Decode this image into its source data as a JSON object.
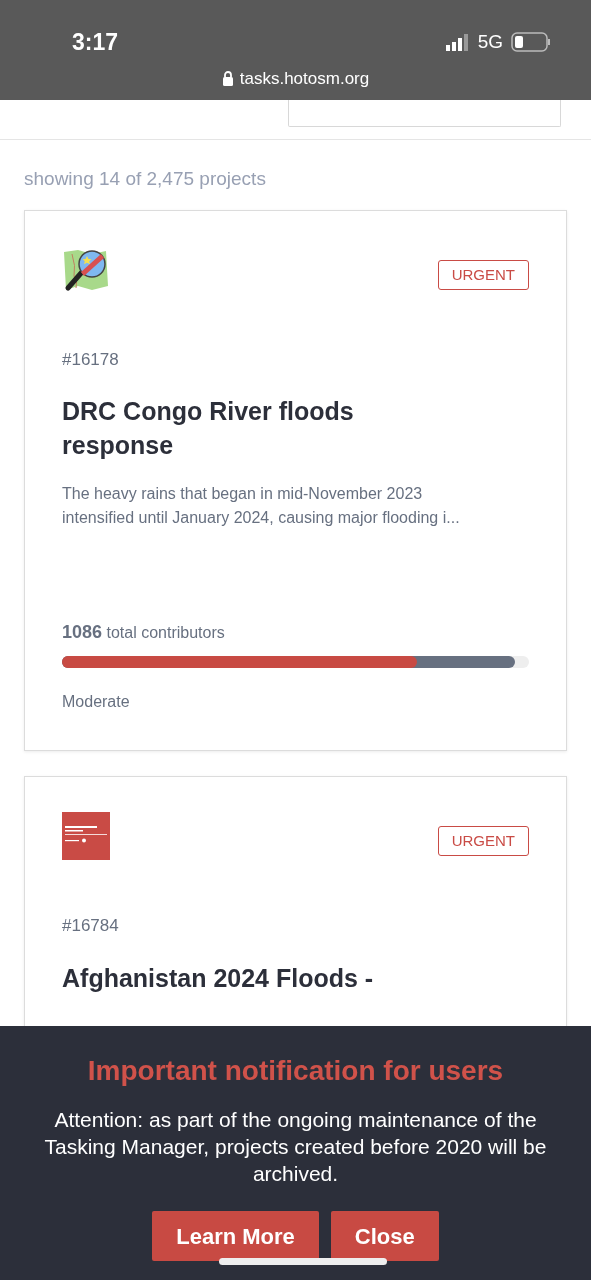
{
  "status_bar": {
    "time": "3:17",
    "network": "5G",
    "url": "tasks.hotosm.org"
  },
  "summary": "showing 14 of 2,475 projects",
  "projects": [
    {
      "logo": {
        "kind": "map"
      },
      "badge": "URGENT",
      "id": "#16178",
      "title": "DRC Congo River floods response",
      "description": "The heavy rains that began in mid-November 2023 intensified until January 2024, causing major flooding i...",
      "contributors_count": "1086",
      "contributors_label": "total contributors",
      "progress": [
        {
          "kind": "validated",
          "level": 0.76
        },
        {
          "kind": "mapped",
          "level": 0.97
        }
      ],
      "difficulty": "Moderate"
    },
    {
      "logo": {
        "kind": "hub"
      },
      "badge": "URGENT",
      "id": "#16784",
      "title": "Afghanistan 2024 Floods -"
    }
  ],
  "notification": {
    "title": "Important notification for users",
    "body": "Attention: as part of the ongoing maintenance of the Tasking Manager, projects created before 2020 will be archived.",
    "buttons": [
      "Learn More",
      "Close"
    ]
  }
}
